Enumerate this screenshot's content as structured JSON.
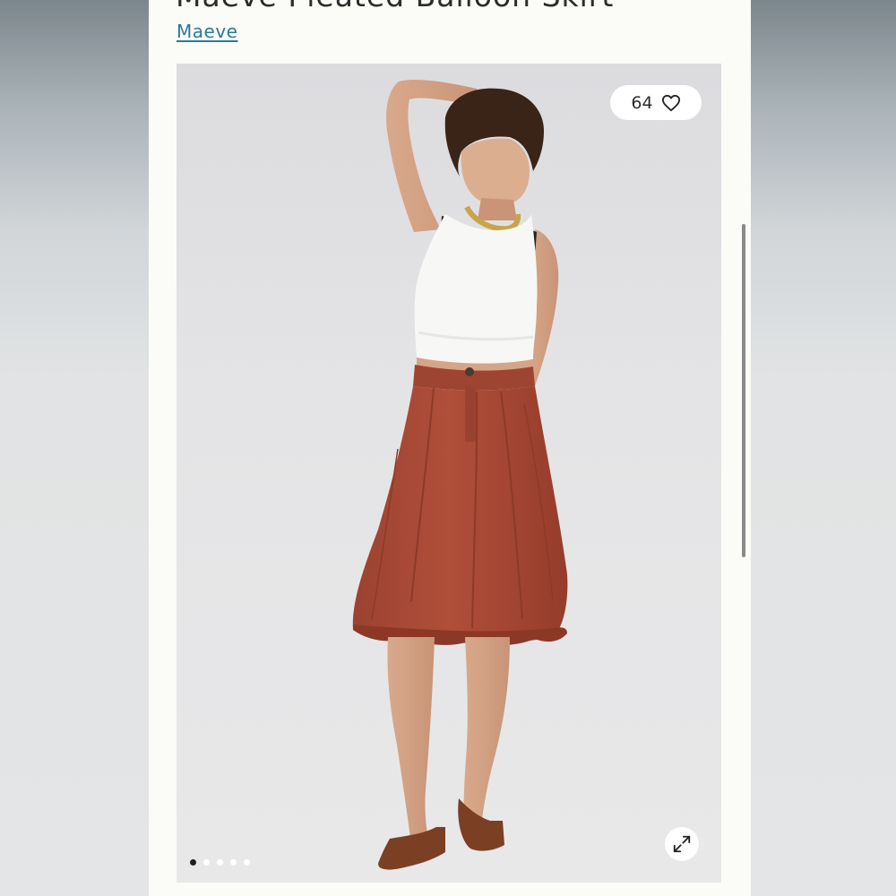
{
  "product": {
    "title": "Maeve Pleated Balloon Skirt",
    "brand": "Maeve"
  },
  "gallery": {
    "like_count": "64",
    "like_icon": "heart-outline-icon",
    "zoom_icon": "expand-arrows-icon",
    "image_count": 5,
    "active_image_index": 0
  },
  "colors": {
    "brand_link": "#2b7a99",
    "skirt": "#a84a36",
    "page_background": "#fbfbf8"
  }
}
